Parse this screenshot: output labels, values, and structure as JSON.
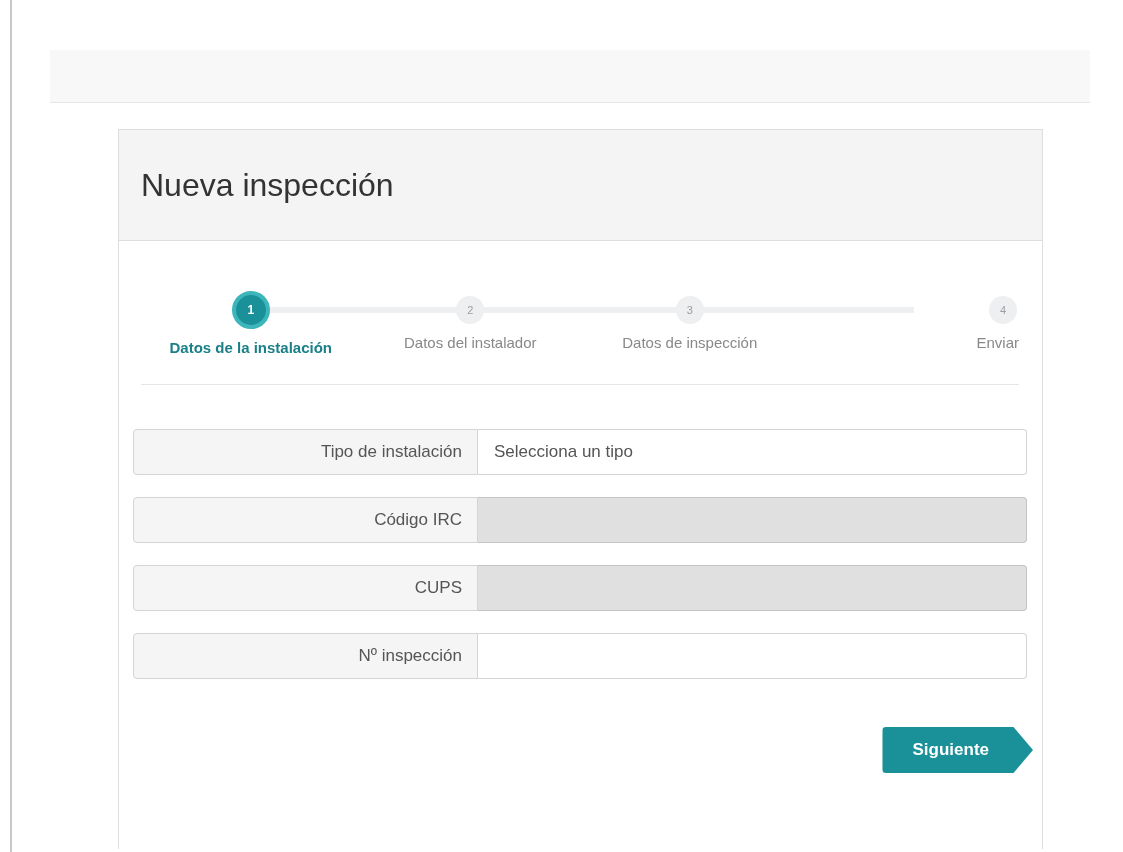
{
  "card": {
    "title": "Nueva inspección"
  },
  "steps": [
    {
      "number": "1",
      "label": "Datos de la instalación",
      "selected": true
    },
    {
      "number": "2",
      "label": "Datos del instalador",
      "selected": false
    },
    {
      "number": "3",
      "label": "Datos de inspección",
      "selected": false
    },
    {
      "number": "4",
      "label": "Enviar",
      "selected": false
    }
  ],
  "fields": [
    {
      "label": "Tipo de instalación",
      "value": "Selecciona un tipo",
      "disabled": false
    },
    {
      "label": "Código IRC",
      "disabled": true
    },
    {
      "label": "CUPS",
      "disabled": true
    },
    {
      "label": "Nº inspección",
      "disabled": false
    }
  ],
  "next_button": {
    "label": "Siguiente"
  }
}
